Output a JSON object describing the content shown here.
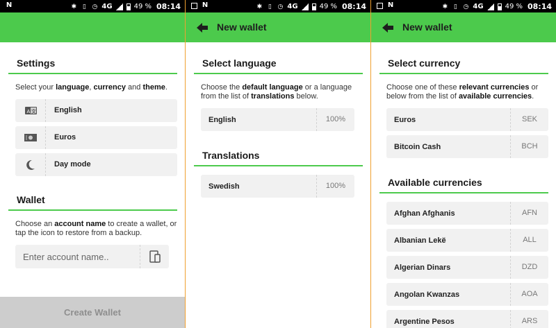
{
  "status_bar": {
    "battery": "49 %",
    "time": "08:14",
    "network": "4G"
  },
  "screen1": {
    "settings": {
      "title": "Settings",
      "desc_pre": "Select your ",
      "desc_b1": "language",
      "desc_mid1": ", ",
      "desc_b2": "currency",
      "desc_mid2": " and ",
      "desc_b3": "theme",
      "desc_post": ".",
      "items": [
        {
          "icon": "language-icon",
          "label": "English"
        },
        {
          "icon": "banknote-icon",
          "label": "Euros"
        },
        {
          "icon": "moon-icon",
          "label": "Day mode"
        }
      ]
    },
    "wallet": {
      "title": "Wallet",
      "desc_pre": "Choose an ",
      "desc_b": "account name",
      "desc_post": " to create a wallet, or tap the icon to restore from a backup.",
      "placeholder": "Enter account name.."
    },
    "create_button": "Create Wallet"
  },
  "screen2": {
    "appbar_title": "New wallet",
    "select_language": {
      "title": "Select language",
      "desc_pre": "Choose the ",
      "desc_b1": "default language",
      "desc_mid": " or a language from the list of ",
      "desc_b2": "translations",
      "desc_post": " below.",
      "default": {
        "label": "English",
        "value": "100%"
      }
    },
    "translations": {
      "title": "Translations",
      "items": [
        {
          "label": "Swedish",
          "value": "100%"
        }
      ]
    }
  },
  "screen3": {
    "appbar_title": "New wallet",
    "select_currency": {
      "title": "Select currency",
      "desc_pre": "Choose one of these ",
      "desc_b1": "relevant currencies",
      "desc_mid": " or below from the list of ",
      "desc_b2": "available currencies",
      "desc_post": ".",
      "items": [
        {
          "label": "Euros",
          "code": "SEK"
        },
        {
          "label": "Bitcoin Cash",
          "code": "BCH"
        }
      ]
    },
    "available": {
      "title": "Available currencies",
      "items": [
        {
          "label": "Afghan Afghanis",
          "code": "AFN"
        },
        {
          "label": "Albanian Lekë",
          "code": "ALL"
        },
        {
          "label": "Algerian Dinars",
          "code": "DZD"
        },
        {
          "label": "Angolan Kwanzas",
          "code": "AOA"
        },
        {
          "label": "Argentine Pesos",
          "code": "ARS"
        }
      ]
    }
  },
  "colors": {
    "accent": "#4cca4c",
    "separator": "#f0a030",
    "row_bg": "#f1f1f1",
    "button_disabled": "#cdcdcd"
  }
}
